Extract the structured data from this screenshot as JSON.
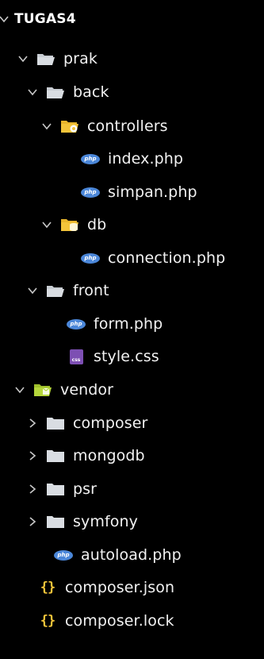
{
  "explorer": {
    "root": {
      "title": "TUGAS4",
      "expanded": true
    },
    "items": [
      {
        "label": "prak",
        "kind": "folder",
        "expanded": true,
        "icon": "folder-open-icon"
      },
      {
        "label": "back",
        "kind": "folder",
        "expanded": true,
        "icon": "folder-open-icon"
      },
      {
        "label": "controllers",
        "kind": "folder",
        "expanded": true,
        "icon": "folder-controllers-icon"
      },
      {
        "label": "index.php",
        "kind": "file",
        "icon": "php-icon"
      },
      {
        "label": "simpan.php",
        "kind": "file",
        "icon": "php-icon"
      },
      {
        "label": "db",
        "kind": "folder",
        "expanded": true,
        "icon": "folder-db-icon"
      },
      {
        "label": "connection.php",
        "kind": "file",
        "icon": "php-icon"
      },
      {
        "label": "front",
        "kind": "folder",
        "expanded": true,
        "icon": "folder-open-icon"
      },
      {
        "label": "form.php",
        "kind": "file",
        "icon": "php-icon"
      },
      {
        "label": "style.css",
        "kind": "file",
        "icon": "css-icon"
      },
      {
        "label": "vendor",
        "kind": "folder",
        "expanded": true,
        "icon": "folder-vendor-icon"
      },
      {
        "label": "composer",
        "kind": "folder",
        "expanded": false,
        "icon": "folder-closed-icon"
      },
      {
        "label": "mongodb",
        "kind": "folder",
        "expanded": false,
        "icon": "folder-closed-icon"
      },
      {
        "label": "psr",
        "kind": "folder",
        "expanded": false,
        "icon": "folder-closed-icon"
      },
      {
        "label": "symfony",
        "kind": "folder",
        "expanded": false,
        "icon": "folder-closed-icon"
      },
      {
        "label": "autoload.php",
        "kind": "file",
        "icon": "php-icon"
      },
      {
        "label": "composer.json",
        "kind": "file",
        "icon": "json-icon"
      },
      {
        "label": "composer.lock",
        "kind": "file",
        "icon": "json-icon"
      }
    ],
    "badges": {
      "php": "php",
      "css": "css",
      "json": "{}"
    },
    "colors": {
      "background": "#000000",
      "text": "#f2f2f2",
      "php": "#4b87d9",
      "css": "#7d4fb3",
      "json": "#f3c43a",
      "folder": "#c8cdd3",
      "folder_special": "#e8b52c",
      "folder_vendor": "#b5d63b"
    }
  }
}
